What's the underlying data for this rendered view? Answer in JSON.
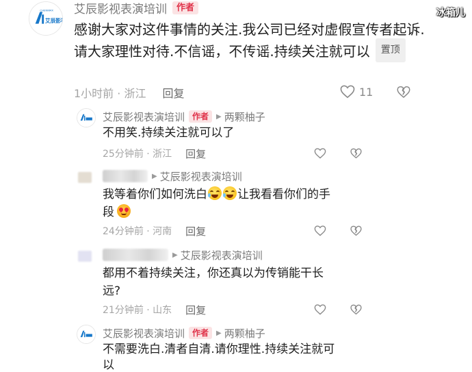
{
  "watermark": "冰箱儿",
  "accent_color": "#e0334a",
  "top_comment": {
    "author": "艾辰影视表演培训",
    "author_badge": "作者",
    "avatar_icon": "aichen-logo-icon",
    "avatar_brand": "艾辰影视",
    "text": "感谢大家对这件事情的关注.我公司已经对虚假宣传者起诉.请大家理性对待.不信谣，不传谣.持续关注就可以",
    "pin_label": "置顶",
    "time_location": "1小时前 · 浙江",
    "reply_label": "回复",
    "like_count": "11"
  },
  "replies": [
    {
      "author": "艾辰影视表演培训",
      "author_badge": "作者",
      "reply_to": "两颗柚子",
      "text": "不用笑.持续关注就可以了",
      "time_location": "25分钟前 · 浙江",
      "reply_label": "回复"
    },
    {
      "reply_to": "艾辰影视表演培训",
      "text_part1": "我等着你们如何洗白",
      "text_part2": "让我看看你们的手",
      "text_part3": "段",
      "time_location": "24分钟前 · 河南",
      "reply_label": "回复"
    },
    {
      "reply_to": "艾辰影视表演培训",
      "text_line1": "都用不着持续关注，你还真以为传销能干长",
      "text_line2": "远?",
      "time_location": "21分钟前 · 山东",
      "reply_label": "回复"
    },
    {
      "author": "艾辰影视表演培训",
      "author_badge": "作者",
      "reply_to": "两颗柚子",
      "text_line1": "不需要洗白.清者自清.请你理性.持续关注就可",
      "text_line2": "以"
    }
  ]
}
